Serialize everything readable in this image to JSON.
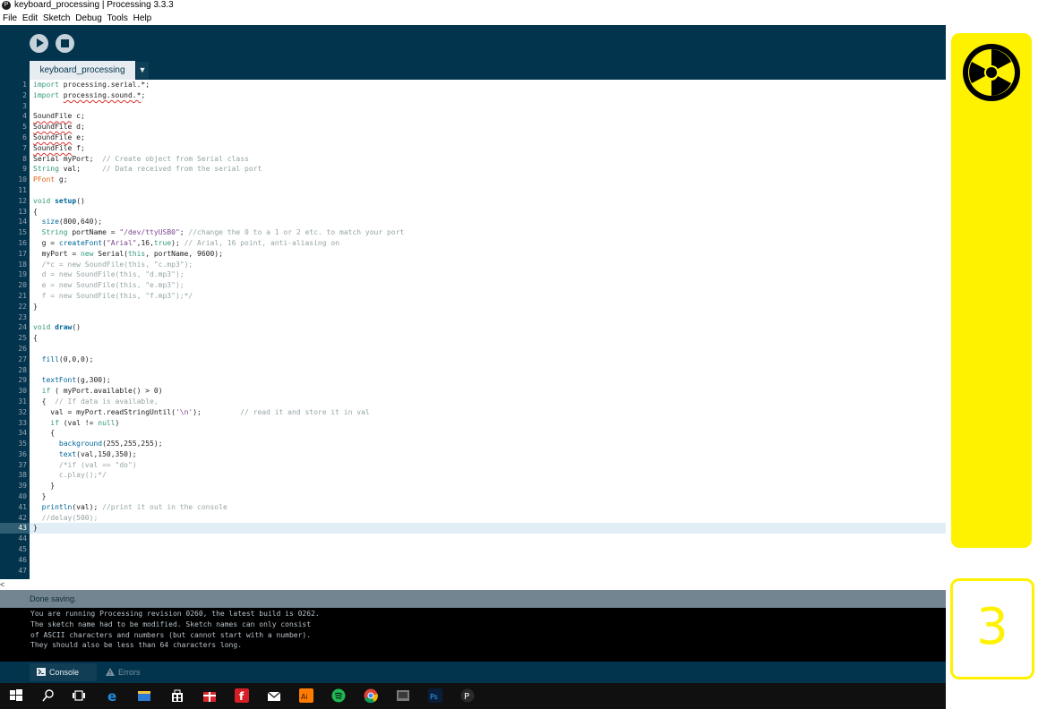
{
  "window": {
    "title": "keyboard_processing | Processing 3.3.3",
    "menu": [
      "File",
      "Edit",
      "Sketch",
      "Debug",
      "Tools",
      "Help"
    ]
  },
  "toolbar": {
    "run": "run",
    "stop": "stop"
  },
  "tab": {
    "label": "keyboard_processing",
    "arrow": "▼"
  },
  "code": [
    "import processing.serial.*;",
    "import processing.sound.*;",
    "",
    "SoundFile c;",
    "SoundFile d;",
    "SoundFile e;",
    "SoundFile f;",
    "Serial myPort;  // Create object from Serial class",
    "String val;     // Data received from the serial port",
    "PFont g;",
    "",
    "void setup()",
    "{",
    "  size(800,640);",
    "  String portName = \"/dev/ttyUSB0\"; //change the 0 to a 1 or 2 etc. to match your port",
    "  g = createFont(\"Arial\",16,true); // Arial, 16 point, anti-aliasing on",
    "  myPort = new Serial(this, portName, 9600);",
    "  /*c = new SoundFile(this, \"c.mp3\");",
    "  d = new SoundFile(this, \"d.mp3\");",
    "  e = new SoundFile(this, \"e.mp3\");",
    "  f = new SoundFile(this, \"f.mp3\");*/",
    "}",
    "",
    "void draw()",
    "{",
    "",
    "  fill(0,0,0);",
    "",
    "  textFont(g,300);",
    "  if ( myPort.available() > 0)",
    "  {  // If data is available,",
    "    val = myPort.readStringUntil('\\n');         // read it and store it in val",
    "    if (val != null)",
    "    {",
    "      background(255,255,255);",
    "      text(val,150,350);",
    "      /*if (val == \"do\")",
    "      c.play();*/",
    "    }",
    "  }",
    "  println(val); //print it out in the console",
    "  //delay(500);",
    "}",
    "",
    "",
    "",
    ""
  ],
  "current_line": 43,
  "hscroll": "<",
  "status": "Done saving.",
  "console": [
    "You are running Processing revision 0260, the latest build is 0262.",
    "The sketch name had to be modified. Sketch names can only consist",
    "of ASCII characters and numbers (but cannot start with a number).",
    "They should also be less than 64 characters long."
  ],
  "bottom_tabs": {
    "console": "Console",
    "errors": "Errors"
  },
  "side_panel": {
    "number": "3"
  },
  "colors": {
    "toolbar_bg": "#02344e",
    "accent_yellow": "#fff200",
    "status_bg": "#738591",
    "console_bg": "#000000"
  },
  "taskbar_icons": [
    "windows-start-icon",
    "search-icon",
    "task-view-icon",
    "edge-icon",
    "file-explorer-icon",
    "store-icon",
    "gift-icon",
    "fritzing-icon",
    "mail-icon",
    "illustrator-icon",
    "spotify-icon",
    "chrome-icon",
    "app-icon",
    "photoshop-icon",
    "processing-icon"
  ]
}
